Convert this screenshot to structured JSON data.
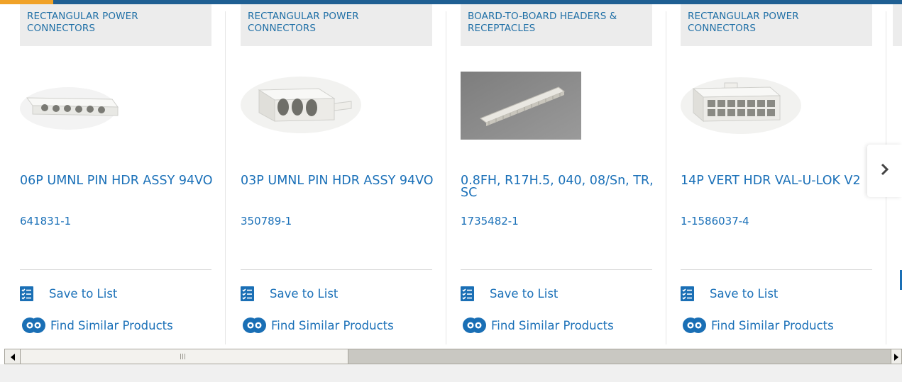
{
  "accent_colors": {
    "brand_blue": "#1f5f93",
    "link_blue": "#1a70b8",
    "highlight_orange": "#f0a228"
  },
  "products": [
    {
      "category": "RECTANGULAR POWER CONNECTORS",
      "title": "06P UMNL PIN HDR ASSY 94VO",
      "part_number": "641831-1",
      "image": "6-pin-connector-photo"
    },
    {
      "category": "RECTANGULAR POWER CONNECTORS",
      "title": "03P UMNL PIN HDR ASSY 94VO",
      "part_number": "350789-1",
      "image": "3-pin-connector-photo"
    },
    {
      "category": "BOARD-TO-BOARD HEADERS & RECEPTACLES",
      "title": "0.8FH, R17H.5, 040, 08/Sn, TR, SC",
      "part_number": "1735482-1",
      "image": "board-to-board-header-photo"
    },
    {
      "category": "RECTANGULAR POWER CONNECTORS",
      "title": "14P VERT HDR VAL-U-LOK V2",
      "part_number": "1-1586037-4",
      "image": "14-pin-header-photo"
    }
  ],
  "actions": {
    "save_label": "Save to List",
    "similar_label": "Find Similar Products"
  },
  "carousel": {
    "next_icon": "chevron-right-icon"
  },
  "scrollbar": {
    "left_icon": "arrow-left-icon",
    "right_icon": "arrow-right-icon",
    "position_fraction": 0.0,
    "visible_fraction": 0.37
  }
}
